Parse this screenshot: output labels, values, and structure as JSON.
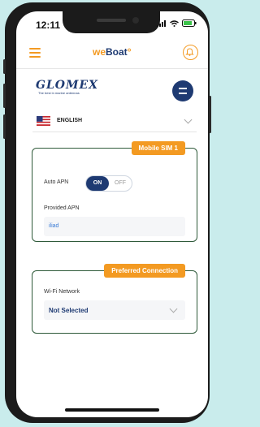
{
  "status_bar": {
    "time": "12:11"
  },
  "header": {
    "app_logo_a": "we",
    "app_logo_b": "Boat",
    "app_logo_c": "°",
    "menu_icon": "hamburger-icon",
    "bell_icon": "bell-icon",
    "accent_color": "#f39a22",
    "brand_color": "#1e3a72"
  },
  "brand": {
    "logo": "GLOMEX",
    "tagline": "The best in marine antennas"
  },
  "language": {
    "selected": "ENGLISH",
    "flag": "us-flag"
  },
  "mobile_sim": {
    "title": "Mobile SIM 1",
    "auto_apn_label": "Auto APN",
    "toggle_on": "ON",
    "toggle_off": "OFF",
    "auto_apn_state": "on",
    "provided_apn_label": "Provided APN",
    "provided_apn_value": "iliad"
  },
  "preferred_connection": {
    "title": "Preferred Connection",
    "wifi_label": "Wi-Fi Network",
    "wifi_value": "Not Selected"
  }
}
